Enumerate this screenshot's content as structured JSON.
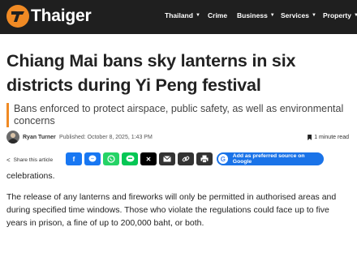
{
  "header": {
    "brand": "Thaiger",
    "nav": [
      {
        "label": "Thailand",
        "dropdown": true
      },
      {
        "label": "Crime",
        "dropdown": false
      },
      {
        "label": "Business",
        "dropdown": true
      },
      {
        "label": "Services",
        "dropdown": true
      },
      {
        "label": "Property",
        "dropdown": true
      }
    ],
    "colors": {
      "bar": "#1f1f1f",
      "accent": "#f08a24"
    }
  },
  "article": {
    "headline": "Chiang Mai bans sky lanterns in six districts during Yi Peng festival",
    "subheadline": "Bans enforced to protect airspace, public safety, as well as environmental concerns",
    "author": "Ryan Turner",
    "published": "Published: October 8, 2025, 1:43 PM",
    "read_time": "1 minute read",
    "body": [
      "celebrations.",
      "The release of any lanterns and fireworks will only be permitted in authorised areas and during specified time windows. Those who violate the regulations could face up to five years in prison, a fine of up to 200,000 baht, or both."
    ]
  },
  "share": {
    "label": "Share this article",
    "buttons": [
      {
        "icon": "facebook-icon",
        "color": "#1877f2"
      },
      {
        "icon": "messenger-icon",
        "color": "#1877f2"
      },
      {
        "icon": "whatsapp-icon",
        "color": "#25d366"
      },
      {
        "icon": "line-icon",
        "color": "#06c755"
      },
      {
        "icon": "x-icon",
        "color": "#000000"
      },
      {
        "icon": "email-icon",
        "color": "#333333"
      },
      {
        "icon": "link-icon",
        "color": "#333333"
      },
      {
        "icon": "print-icon",
        "color": "#333333"
      }
    ],
    "preferred_source": "Add as preferred source on Google"
  }
}
